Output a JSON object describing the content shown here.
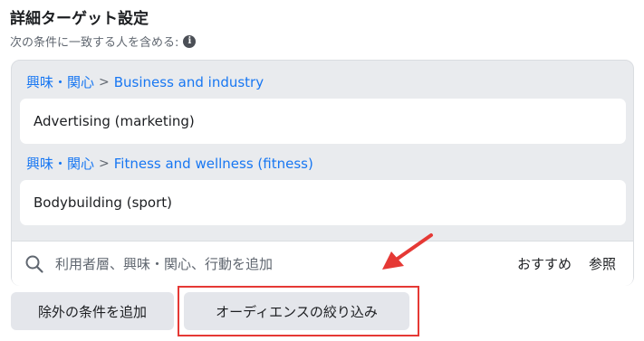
{
  "section": {
    "title": "詳細ターゲット設定",
    "subtitle": "次の条件に一致する人を含める:",
    "info_icon": "info-icon"
  },
  "targeting": {
    "groups": [
      {
        "category": "興味・関心",
        "separator": ">",
        "subcategory": "Business and industry",
        "item": "Advertising (marketing)"
      },
      {
        "category": "興味・関心",
        "separator": ">",
        "subcategory": "Fitness and wellness (fitness)",
        "item": "Bodybuilding (sport)"
      }
    ],
    "search": {
      "placeholder": "利用者層、興味・関心、行動を追加",
      "icon": "search-icon",
      "recommend_label": "おすすめ",
      "browse_label": "参照"
    }
  },
  "actions": {
    "exclude_label": "除外の条件を追加",
    "narrow_label": "オーディエンスの絞り込み"
  },
  "colors": {
    "link_blue": "#1877f2",
    "panel_gray": "#e9ebee",
    "button_gray": "#e4e6eb",
    "annotation_red": "#e53935"
  }
}
